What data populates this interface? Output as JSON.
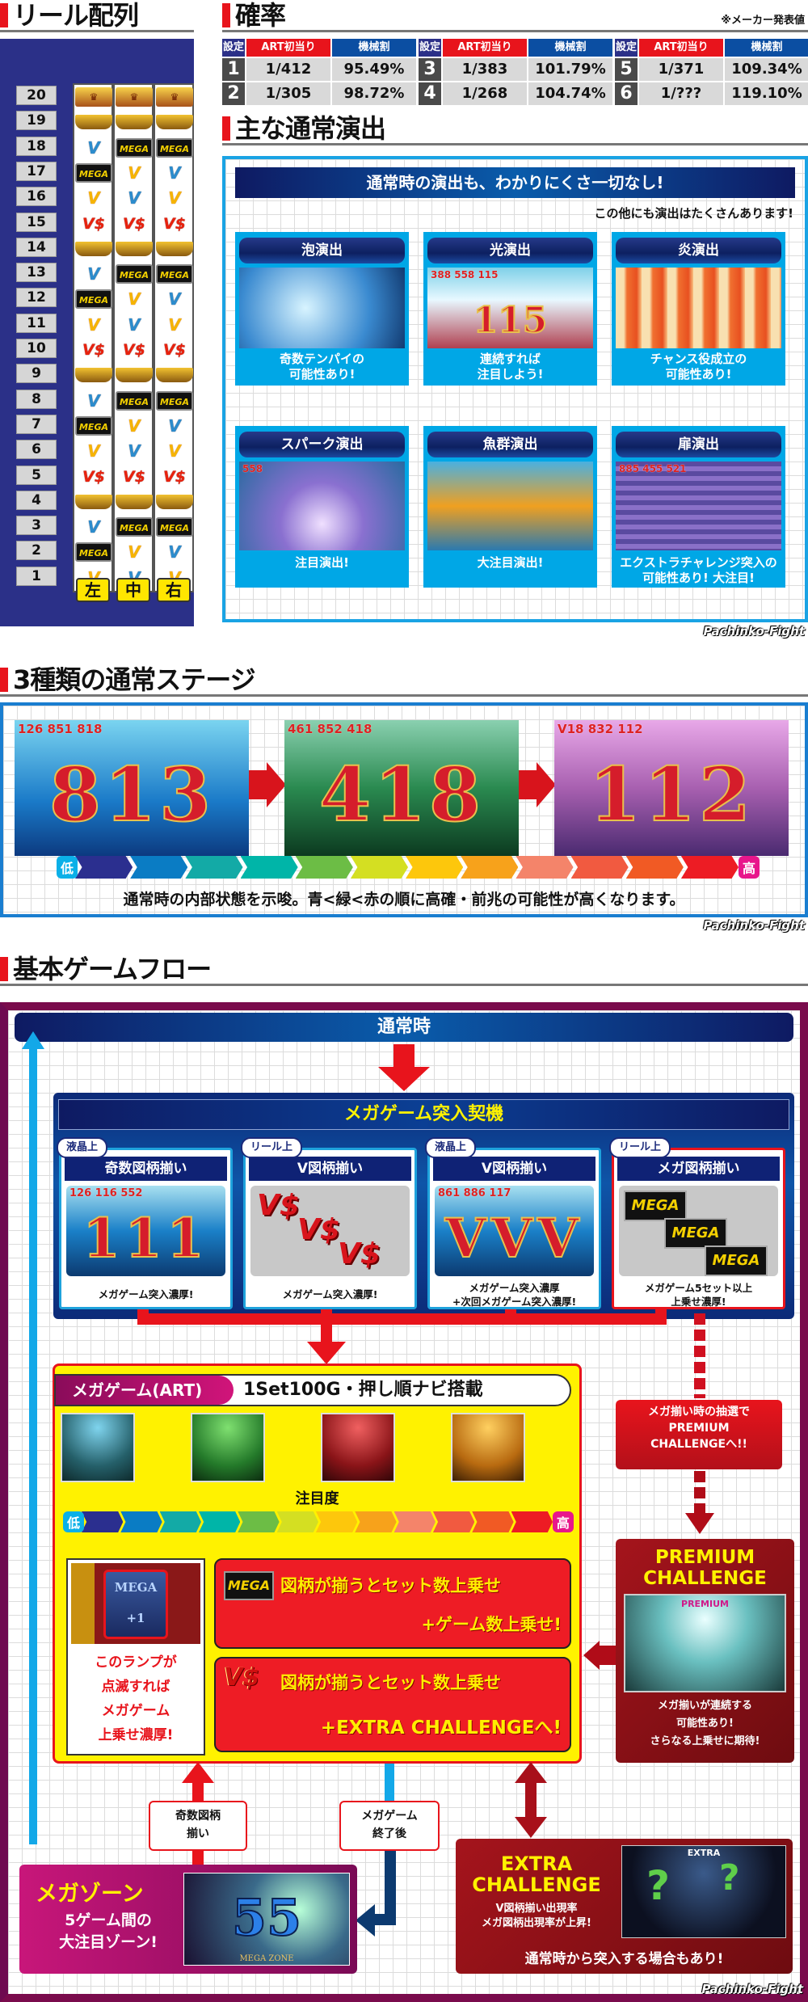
{
  "reel": {
    "title": "リール配列",
    "numbers": [
      "20",
      "19",
      "18",
      "17",
      "16",
      "15",
      "14",
      "13",
      "12",
      "11",
      "10",
      "9",
      "8",
      "7",
      "6",
      "5",
      "4",
      "3",
      "2",
      "1"
    ],
    "symbol_labels": {
      "crown": "♛",
      "gold": "",
      "mega": "MEGA",
      "vy": "V",
      "vb": "V",
      "vs": "V$"
    },
    "strips": [
      [
        "crown",
        "gold",
        "vb",
        "mega",
        "vy",
        "vs",
        "gold",
        "vb",
        "mega",
        "vy",
        "vs",
        "gold",
        "vb",
        "mega",
        "vy",
        "vs",
        "gold",
        "vb",
        "mega",
        "vy"
      ],
      [
        "crown",
        "gold",
        "mega",
        "vy",
        "vb",
        "vs",
        "gold",
        "mega",
        "vy",
        "vb",
        "vs",
        "gold",
        "mega",
        "vy",
        "vb",
        "vs",
        "gold",
        "mega",
        "vy",
        "vb"
      ],
      [
        "crown",
        "gold",
        "mega",
        "vb",
        "vy",
        "vs",
        "gold",
        "mega",
        "vb",
        "vy",
        "vs",
        "gold",
        "mega",
        "vb",
        "vy",
        "vs",
        "gold",
        "mega",
        "vb",
        "vy"
      ]
    ],
    "buttons": [
      "左",
      "中",
      "右"
    ]
  },
  "probability": {
    "title": "確率",
    "note": "※メーカー発表値",
    "headers": {
      "setting": "設定",
      "art": "ART初当り",
      "payout": "機械割"
    },
    "rows": [
      {
        "setting": "1",
        "art": "1/412",
        "payout": "95.49%"
      },
      {
        "setting": "2",
        "art": "1/305",
        "payout": "98.72%"
      },
      {
        "setting": "3",
        "art": "1/383",
        "payout": "101.79%"
      },
      {
        "setting": "4",
        "art": "1/268",
        "payout": "104.74%"
      },
      {
        "setting": "5",
        "art": "1/371",
        "payout": "109.34%"
      },
      {
        "setting": "6",
        "art": "1/???",
        "payout": "119.10%"
      }
    ],
    "colors": {
      "art_header": "#e8141c",
      "payout_header": "#0b4ea2",
      "setting_header": "#2b3088"
    }
  },
  "effects": {
    "title": "主な通常演出",
    "banner": "通常時の演出も、わかりにくさ一切なし!",
    "sub": "この他にも演出はたくさんあります!",
    "cards": [
      {
        "title": "泡演出",
        "caption": "奇数テンパイの\n可能性あり!",
        "img_nums": "",
        "big": ""
      },
      {
        "title": "光演出",
        "caption": "連続すれば\n注目しよう!",
        "img_nums": "388 558 115",
        "big": "115"
      },
      {
        "title": "炎演出",
        "caption": "チャンス役成立の\n可能性あり!",
        "img_nums": "",
        "big": ""
      },
      {
        "title": "スパーク演出",
        "caption": "注目演出!",
        "img_nums": "558",
        "big": ""
      },
      {
        "title": "魚群演出",
        "caption": "大注目演出!",
        "img_nums": "",
        "big": ""
      },
      {
        "title": "扉演出",
        "caption": "エクストラチャレンジ突入の\n可能性あり! 大注目!",
        "img_nums": "885 455 521",
        "big": ""
      }
    ]
  },
  "watermark": "Pachinko-Fight",
  "stages": {
    "title": "3種類の通常ステージ",
    "items": [
      {
        "nums": "126 851 818",
        "big": "813"
      },
      {
        "nums": "461 852 418",
        "big": "418"
      },
      {
        "nums": "V18 832 112",
        "big": "112"
      }
    ],
    "low": "低",
    "high": "高",
    "caption": "通常時の内部状態を示唆。青<緑<赤の順に高確・前兆の可能性が高くなります。"
  },
  "gauge_colors": [
    "#2b2f8f",
    "#0a7cc4",
    "#13aaa6",
    "#00b5a8",
    "#6cbd45",
    "#d4df22",
    "#fdc70c",
    "#f7a21b",
    "#f4846a",
    "#f15a40",
    "#f15a24",
    "#ed1c24"
  ],
  "flow": {
    "title": "基本ゲームフロー",
    "normal": "通常時",
    "trigger_title": "メガゲーム突入契機",
    "triggers": [
      {
        "tag": "液晶上",
        "title": "奇数図柄揃い",
        "caption": "メガゲーム突入濃厚!",
        "nums": "126 116 552",
        "big": "111"
      },
      {
        "tag": "リール上",
        "title": "V図柄揃い",
        "caption": "メガゲーム突入濃厚!",
        "sym": "V$"
      },
      {
        "tag": "液晶上",
        "title": "V図柄揃い",
        "caption": "メガゲーム突入濃厚\n+次回メガゲーム突入濃厚!",
        "nums": "861 886 117",
        "big": "VVV"
      },
      {
        "tag": "リール上",
        "title": "メガ図柄揃い",
        "caption": "メガゲーム5セット以上\n上乗せ濃厚!",
        "sym": "MEGA"
      }
    ],
    "megagame": {
      "label": "メガゲーム(ART)",
      "desc": "1Set100G・押し順ナビ搭載",
      "attention": "注目度",
      "low": "低",
      "high": "高",
      "lamp_img": "MEGA +1",
      "lamp_caption": "このランプが\n点滅すれば\nメガゲーム\n上乗せ濃厚!",
      "mega_sym": "MEGA",
      "mega_line1": "図柄が揃うとセット数上乗せ",
      "mega_line2": "+ゲーム数上乗せ!",
      "vs_sym": "V$",
      "vs_line1": "図柄が揃うとセット数上乗せ",
      "vs_line2": "+EXTRA CHALLENGEへ!"
    },
    "premium_note": "メガ揃い時の抽選で\nPREMIUM\nCHALLENGEへ!!",
    "premium": {
      "title": "PREMIUM\nCHALLENGE",
      "img": "PREMIUM",
      "caption": "メガ揃いが連続する\n可能性あり!\nさらなる上乗せに期待!"
    },
    "odd_label": "奇数図柄\n揃い",
    "end_label": "メガゲーム\n終了後",
    "megazone": {
      "title": "メガゾーン",
      "caption": "5ゲーム間の\n大注目ゾーン!",
      "big": "55",
      "img_label": "MEGA ZONE"
    },
    "extra": {
      "title": "EXTRA\nCHALLENGE",
      "desc": "V図柄揃い出現率\nメガ図柄出現率が上昇!",
      "img": "EXTRA",
      "caption": "通常時から突入する場合もあり!"
    }
  }
}
